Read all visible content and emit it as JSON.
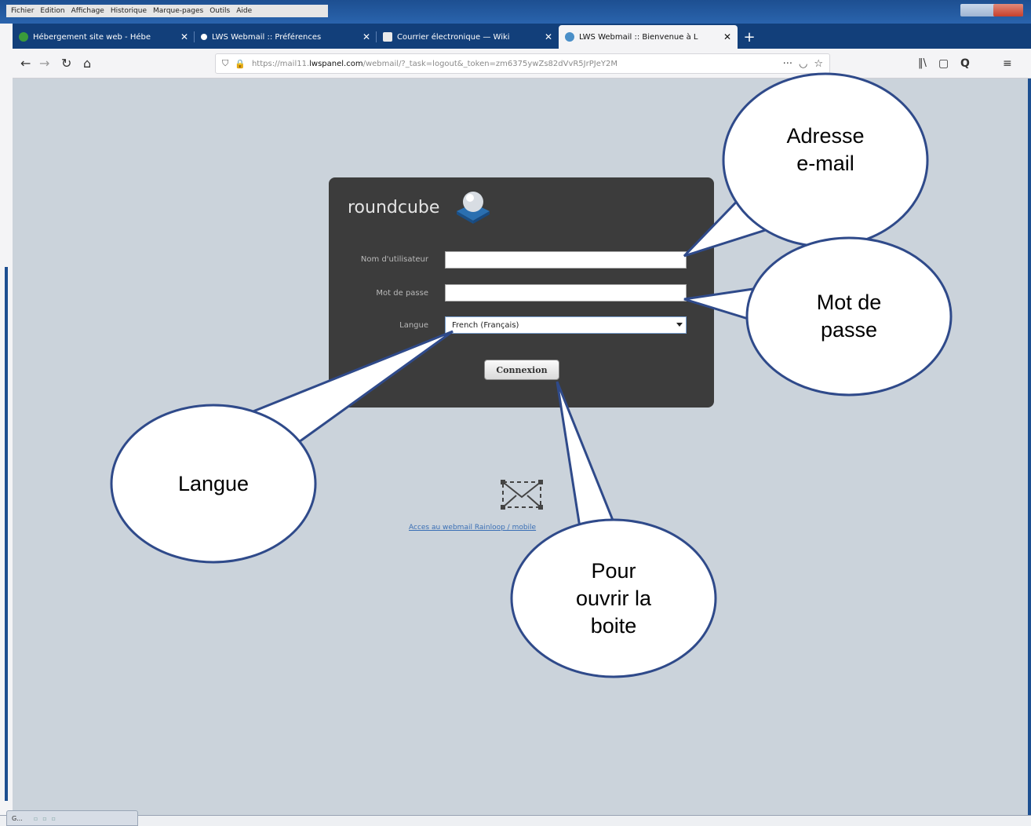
{
  "menubar": {
    "items": [
      "Fichier",
      "Edition",
      "Affichage",
      "Historique",
      "Marque-pages",
      "Outils",
      "Aide"
    ]
  },
  "tabs": [
    {
      "label": "Hébergement site web - Hébe",
      "icon": "lws-icon"
    },
    {
      "label": "LWS Webmail :: Préférences",
      "icon": "webmail-icon"
    },
    {
      "label": "Courrier électronique — Wiki",
      "icon": "wikipedia-icon"
    },
    {
      "label": "LWS Webmail :: Bienvenue à L",
      "icon": "roundcube-icon"
    }
  ],
  "navbar": {
    "url_prefix": "https://mail11.",
    "url_domain": "lwspanel.com",
    "url_suffix": "/webmail/?_task=logout&_token=zm6375ywZs82dVvR5JrPJeY2M"
  },
  "login": {
    "logo_text": "roundcube",
    "username_label": "Nom d'utilisateur",
    "password_label": "Mot de passe",
    "language_label": "Langue",
    "language_value": "French (Français)",
    "submit_label": "Connexion",
    "mobile_link": "Acces au webmail Rainloop / mobile"
  },
  "callouts": {
    "email": [
      "Adresse",
      "e-mail"
    ],
    "password": [
      "Mot de",
      "passe"
    ],
    "language": [
      "Langue"
    ],
    "open": [
      "Pour",
      "ouvrir la",
      "boite"
    ]
  },
  "taskbar": {
    "label": "G..."
  },
  "colors": {
    "page_bg": "#cbd3db",
    "login_box": "#3c3c3c",
    "callout_stroke": "#2f4a8a",
    "titlebar": "#1d4f91"
  }
}
